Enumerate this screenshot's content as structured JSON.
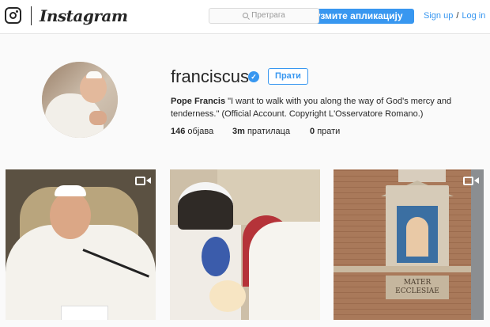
{
  "header": {
    "wordmark": "Instagram",
    "search_placeholder": "Претрага",
    "app_button_label": "реузмите апликацију",
    "signup_label": "Sign up",
    "separator": "/",
    "login_label": "Log in"
  },
  "profile": {
    "username": "franciscus",
    "verified": true,
    "follow_label": "Прати",
    "full_name": "Pope Francis",
    "bio": "\"I want to walk with you along the way of God's mercy and tenderness.\" (Official Account. Copyright L'Osservatore Romano.)",
    "stats": {
      "posts_count": "146",
      "posts_label": "објава",
      "followers_count": "3m",
      "followers_label": "пратилаца",
      "following_count": "0",
      "following_label": "прати"
    }
  },
  "posts": [
    {
      "type": "video",
      "has_video_icon": true
    },
    {
      "type": "image",
      "has_video_icon": false
    },
    {
      "type": "video",
      "has_video_icon": true,
      "plaque_text": "MATER ECCLESIAE"
    }
  ],
  "colors": {
    "accent": "#3897f0",
    "text": "#262626",
    "background": "#fafafa"
  }
}
